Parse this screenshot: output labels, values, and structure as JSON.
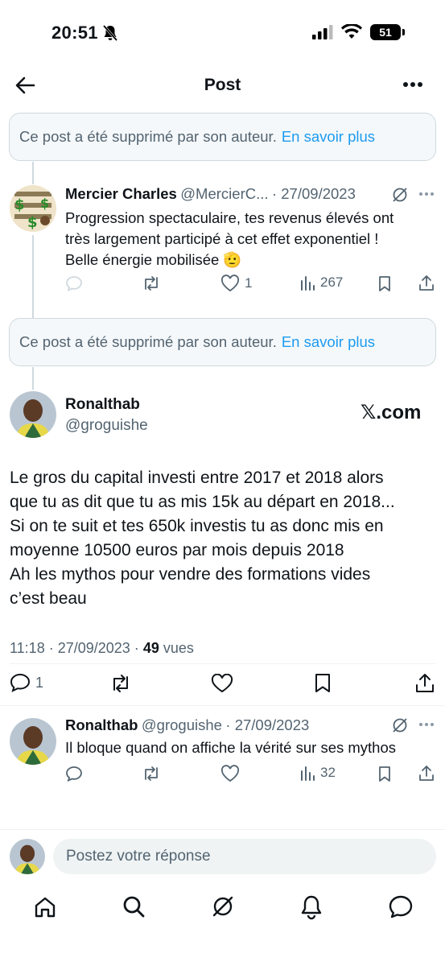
{
  "status": {
    "time": "20:51",
    "battery": "51"
  },
  "header": {
    "title": "Post"
  },
  "notices": [
    {
      "text": "Ce post a été supprimé par son auteur.",
      "link": "En savoir plus"
    },
    {
      "text": "Ce post a été supprimé par son auteur.",
      "link": "En savoir plus"
    }
  ],
  "reply1": {
    "name": "Mercier Charles",
    "handle": "@MercierC...",
    "date": "· 27/09/2023",
    "lines": [
      "Progression spectaculaire, tes revenus élevés ont",
      "très  largement participé à cet effet exponentiel !",
      "Belle énergie mobilisée 🫡"
    ],
    "likes": "1",
    "views": "267"
  },
  "main": {
    "name": "Ronalthab",
    "handle": "@groguishe",
    "brand": "𝕏.com",
    "lines": [
      "Le gros du capital investi entre 2017 et 2018 alors",
      "que tu as dit que tu as mis 15k au départ en 2018...",
      "Si on te suit et tes 650k investis tu as donc mis en",
      "moyenne 10500 euros par mois depuis 2018",
      "Ah les mythos pour vendre des formations vides",
      "c’est beau"
    ],
    "time": "11:18 · 27/09/2023 ·",
    "views_count": "49",
    "views_label": "vues",
    "replies": "1"
  },
  "reply2": {
    "name": "Ronalthab",
    "handle": "@groguishe",
    "date": "· 27/09/2023",
    "text": "Il bloque quand on affiche la vérité sur ses mythos",
    "views": "32"
  },
  "composer": {
    "placeholder": "Postez votre réponse"
  },
  "colors": {
    "accent": "#1d9bf0",
    "muted": "#536471",
    "text": "#0f1419",
    "border": "#cfd9de"
  }
}
